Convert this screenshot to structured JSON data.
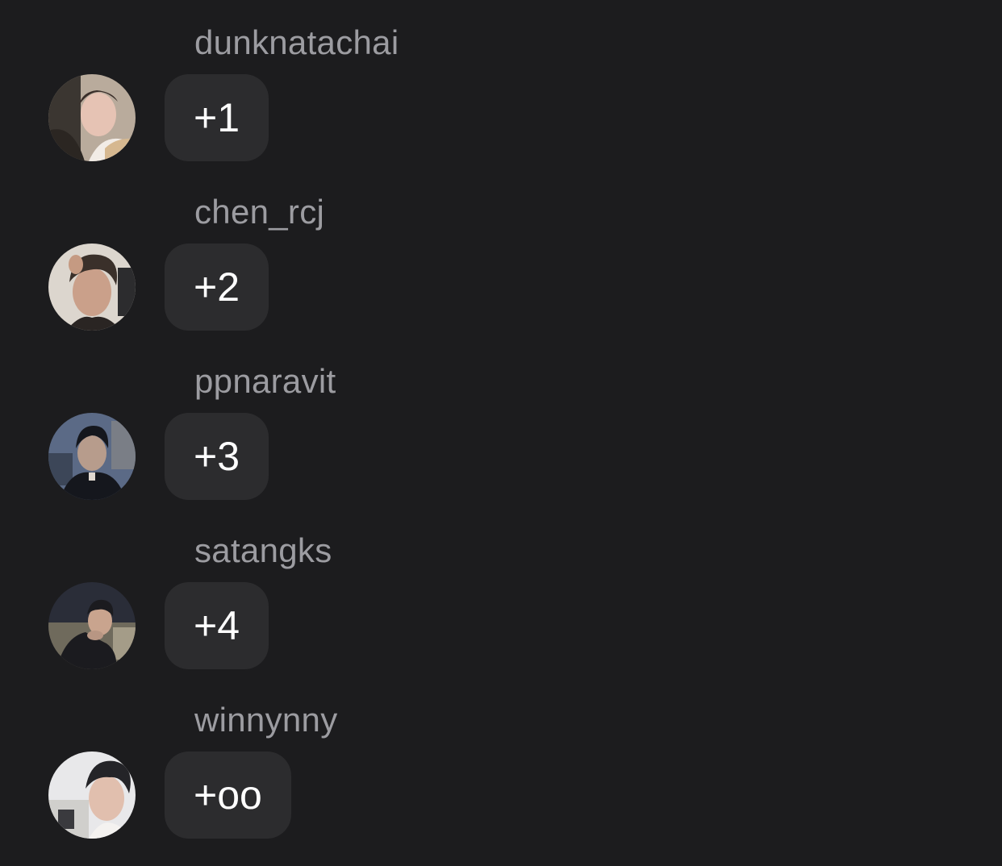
{
  "messages": [
    {
      "sender": "dunknatachai",
      "text": "+1",
      "avatar_icon": "profile-photo",
      "avatar_colors": [
        "#c9b9a6",
        "#2b2622",
        "#e6c3b4"
      ]
    },
    {
      "sender": "chen_rcj",
      "text": "+2",
      "avatar_icon": "profile-photo",
      "avatar_colors": [
        "#d8d2ca",
        "#3a302a",
        "#caa08a"
      ]
    },
    {
      "sender": "ppnaravit",
      "text": "+3",
      "avatar_icon": "profile-photo",
      "avatar_colors": [
        "#5b6a86",
        "#15171d",
        "#b79c8c"
      ]
    },
    {
      "sender": "satangks",
      "text": "+4",
      "avatar_icon": "profile-photo",
      "avatar_colors": [
        "#6f6a5c",
        "#1b1b1f",
        "#c9a48e"
      ]
    },
    {
      "sender": "winnynny",
      "text": "+oo",
      "avatar_icon": "profile-photo",
      "avatar_colors": [
        "#e8e8ea",
        "#242428",
        "#e1bfae"
      ]
    }
  ]
}
